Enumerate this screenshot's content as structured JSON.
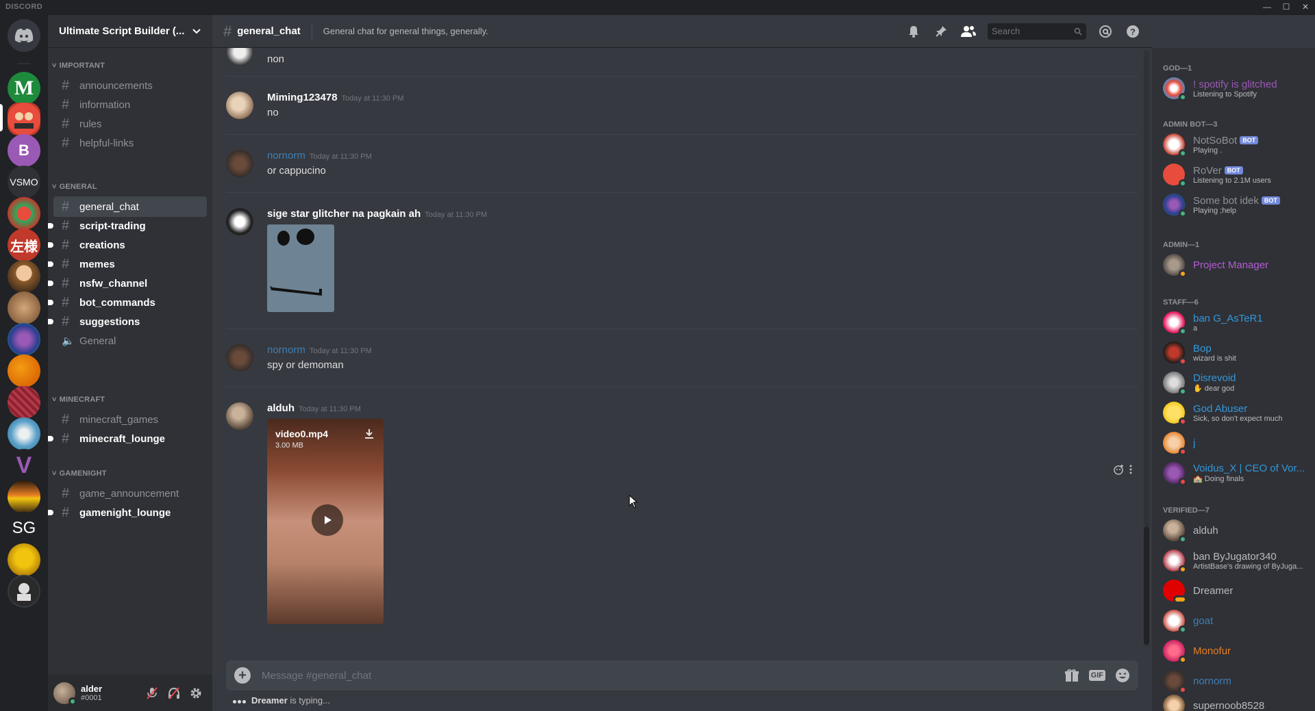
{
  "titlebar": {
    "brand": "DISCORD",
    "minimize": "—",
    "maximize": "☐",
    "close": "✕"
  },
  "servers": [
    {
      "label": "",
      "color": "#36393f"
    },
    {
      "label": "M",
      "color": "#1e8a3c"
    },
    {
      "label": "",
      "color": "#c0392b"
    },
    {
      "label": "B",
      "color": "#9b59b6"
    },
    {
      "label": "VSMO",
      "color": "#2f3136"
    },
    {
      "label": "",
      "color": "#b33a3a"
    },
    {
      "label": "左様",
      "color": "#c0392b"
    },
    {
      "label": "",
      "color": "#8b5a2b"
    },
    {
      "label": "",
      "color": "#a67c52"
    },
    {
      "label": "",
      "color": "#2c3e8f"
    },
    {
      "label": "",
      "color": "#e67e22"
    },
    {
      "label": "",
      "color": "#b03a48"
    },
    {
      "label": "",
      "color": "#5aa0c8"
    },
    {
      "label": "V",
      "color": "#202225"
    },
    {
      "label": "",
      "color": "#d35400"
    },
    {
      "label": "SG",
      "color": "#202225"
    },
    {
      "label": "",
      "color": "#d4a017"
    },
    {
      "label": "",
      "color": "#36393f"
    }
  ],
  "guild": {
    "name": "Ultimate Script Builder (..."
  },
  "categories": {
    "important": "IMPORTANT",
    "general": "GENERAL",
    "minecraft": "MINECRAFT",
    "gamenight": "GAMENIGHT"
  },
  "channels": {
    "announcements": "announcements",
    "information": "information",
    "rules": "rules",
    "helpful_links": "helpful-links",
    "general_chat": "general_chat",
    "script_trading": "script-trading",
    "creations": "creations",
    "memes": "memes",
    "nsfw_channel": "nsfw_channel",
    "bot_commands": "bot_commands",
    "suggestions": "suggestions",
    "voice_general": "General",
    "minecraft_games": "minecraft_games",
    "minecraft_lounge": "minecraft_lounge",
    "game_announcement": "game_announcement",
    "gamenight_lounge": "gamenight_lounge"
  },
  "user": {
    "name": "alder",
    "discriminator": "#0001"
  },
  "header": {
    "channel": "general_chat",
    "topic": "General chat for general things, generally.",
    "search_placeholder": "Search"
  },
  "messages": [
    {
      "text": "non"
    },
    {
      "author": "Miming123478",
      "time": "Today at 11:30 PM",
      "text": "no"
    },
    {
      "author": "nornorm",
      "time": "Today at 11:30 PM",
      "text": "or cappucino"
    },
    {
      "author": "sige star glitcher na pagkain ah",
      "time": "Today at 11:30 PM"
    },
    {
      "author": "nornorm",
      "time": "Today at 11:30 PM",
      "text": "spy or demoman"
    },
    {
      "author": "alduh",
      "time": "Today at 11:30 PM"
    }
  ],
  "attachment": {
    "name": "video0.mp4",
    "size": "3.00 MB"
  },
  "composer": {
    "placeholder": "Message #general_chat",
    "gif": "GIF"
  },
  "typing": {
    "user": "Dreamer",
    "suffix": " is typing..."
  },
  "member_groups": {
    "god": "GOD—1",
    "admin_bot": "ADMIN BOT—3",
    "admin": "ADMIN—1",
    "staff": "STAFF—6",
    "verified": "VERIFIED—7"
  },
  "members": [
    {
      "name": "! spotify is glitched",
      "activity": "Listening to Spotify",
      "color": "#9b59b6"
    },
    {
      "name": "NotSoBot",
      "activity": "Playing .",
      "color": "#8e9297",
      "bot": "BOT"
    },
    {
      "name": "RoVer",
      "activity": "Listening to 2.1M users",
      "color": "#8e9297",
      "bot": "BOT"
    },
    {
      "name": "Some bot idek",
      "activity": "Playing ;help",
      "color": "#8e9297",
      "bot": "BOT"
    },
    {
      "name": "Project Manager",
      "activity": "",
      "color": "#b45cd6"
    },
    {
      "name": "ban G_AsTeR1",
      "activity": "a",
      "color": "#3498db"
    },
    {
      "name": "Bop",
      "activity": "wizard is shit",
      "color": "#3498db"
    },
    {
      "name": "Disrevoid",
      "activity": "dear god",
      "color": "#3498db"
    },
    {
      "name": "God Abuser",
      "activity": "Sick, so don't expect much",
      "color": "#3498db"
    },
    {
      "name": "j",
      "activity": "",
      "color": "#3498db"
    },
    {
      "name": "Voidus_X | CEO of Vor...",
      "activity": "Doing finals",
      "color": "#3498db"
    },
    {
      "name": "alduh",
      "activity": "",
      "color": "#b9bbbe"
    },
    {
      "name": "ban ByJugator340",
      "activity": "ArtistBase's drawing of ByJuga...",
      "color": "#b9bbbe"
    },
    {
      "name": "Dreamer",
      "activity": "",
      "color": "#b9bbbe"
    },
    {
      "name": "goat",
      "activity": "",
      "color": "#3e7fb8"
    },
    {
      "name": "Monofur",
      "activity": "",
      "color": "#e67e22"
    },
    {
      "name": "nornorm",
      "activity": "",
      "color": "#3e7fb8"
    },
    {
      "name": "supernoob8528",
      "activity": "",
      "color": "#b9bbbe"
    }
  ]
}
